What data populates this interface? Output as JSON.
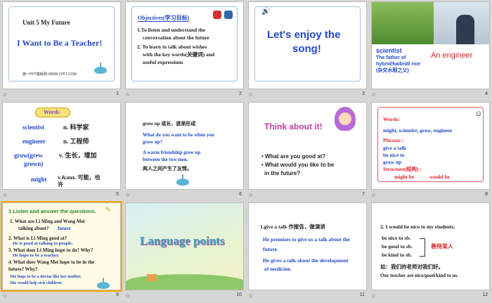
{
  "slides": [
    {
      "num": "1",
      "unit": "Unit 5  My Future",
      "title": "I Want to Be a Teacher!",
      "footer": "第一PPT模板网-WWW.1PPT.COM"
    },
    {
      "num": "2",
      "heading": "Objectives(学习目标)",
      "items": [
        "1.To listen and understand the",
        "conversation about the future",
        "2. To learn to talk about wishes",
        "with the key words(关键词) and",
        "useful expressions"
      ]
    },
    {
      "num": "3",
      "title_l1": "Let's enjoy the",
      "title_l2": "song!"
    },
    {
      "num": "4",
      "l1": "scientist",
      "l2": "The father of",
      "l3": "hybrid/haibrid/ rice",
      "l4": "(杂交水稻之父)",
      "r1": "An engineer"
    },
    {
      "num": "5",
      "badge": "Words",
      "w1": "scientist",
      "m1": "n. 科学家",
      "w2": "engineer",
      "m2": "n. 工程师",
      "w3a": "grow(grew",
      "w3b": "grown)",
      "m3": "v. 生长，增加",
      "w4": "might",
      "m4a": "v.&aux. 可能，也",
      "m4b": "许"
    },
    {
      "num": "6",
      "l1": "grow up 成长，逐渐形成",
      "l2": "What  do you want  to be when you",
      "l3": "grow up?",
      "l4": "A warm  friendship  grew up",
      "l5": "between the two men.",
      "l6": "两人之间产生了友情。"
    },
    {
      "num": "7",
      "title": "Think about it!",
      "q1": "• What are you good at?",
      "q2": "• What  would you like to be",
      "q3": "in the future?"
    },
    {
      "num": "8",
      "l1": "Words:",
      "l2": "might, scientist, grow, engineer",
      "l3": "Phrases :",
      "l4": "give a talk",
      "l5": "be nice to",
      "l6": "grow up",
      "l7": "Structure(结构) :",
      "l8a": "might be",
      "l8b": "would  be"
    },
    {
      "num": "9",
      "h": "1 Listen and answer the questions.",
      "q1a": "1.   What are Li Ming and Wang Mei",
      "q1b": "talking about?",
      "a1": "future",
      "q2": "2. What is Li Ming good at?",
      "a2": "He is good at talking to people.",
      "q3": "3. What does Li Ming hope to do? Why?",
      "a3": "He hope to be a teacher.",
      "q4a": "4. What does Wang Mei hope to be in the",
      "q4b": "future? Why?",
      "a4a": "She hope  to be a doctor  like her mother.",
      "a4b": "She would  help  sick children."
    },
    {
      "num": "10",
      "title": "Language points"
    },
    {
      "num": "11",
      "l1": "1.give a talk 作报告，做演讲",
      "l2": "He promises to give us a talk about the",
      "l3": "future.",
      "l4": "He gives a talk about the development",
      "l5": "of  medicine."
    },
    {
      "num": "12",
      "l1": "2. I would be nice to my  students.",
      "l2": "be nice to sb.",
      "l3": "be good to sb.",
      "l4": "be kind to sb.",
      "l5": "善待某人",
      "l6": "如：我们的老师对我们好。",
      "l7": "Our teacher are nice/good/kind to us."
    }
  ],
  "colors": {
    "blue": "#2248c8",
    "red": "#e0222a",
    "selected": "#f2a900"
  }
}
